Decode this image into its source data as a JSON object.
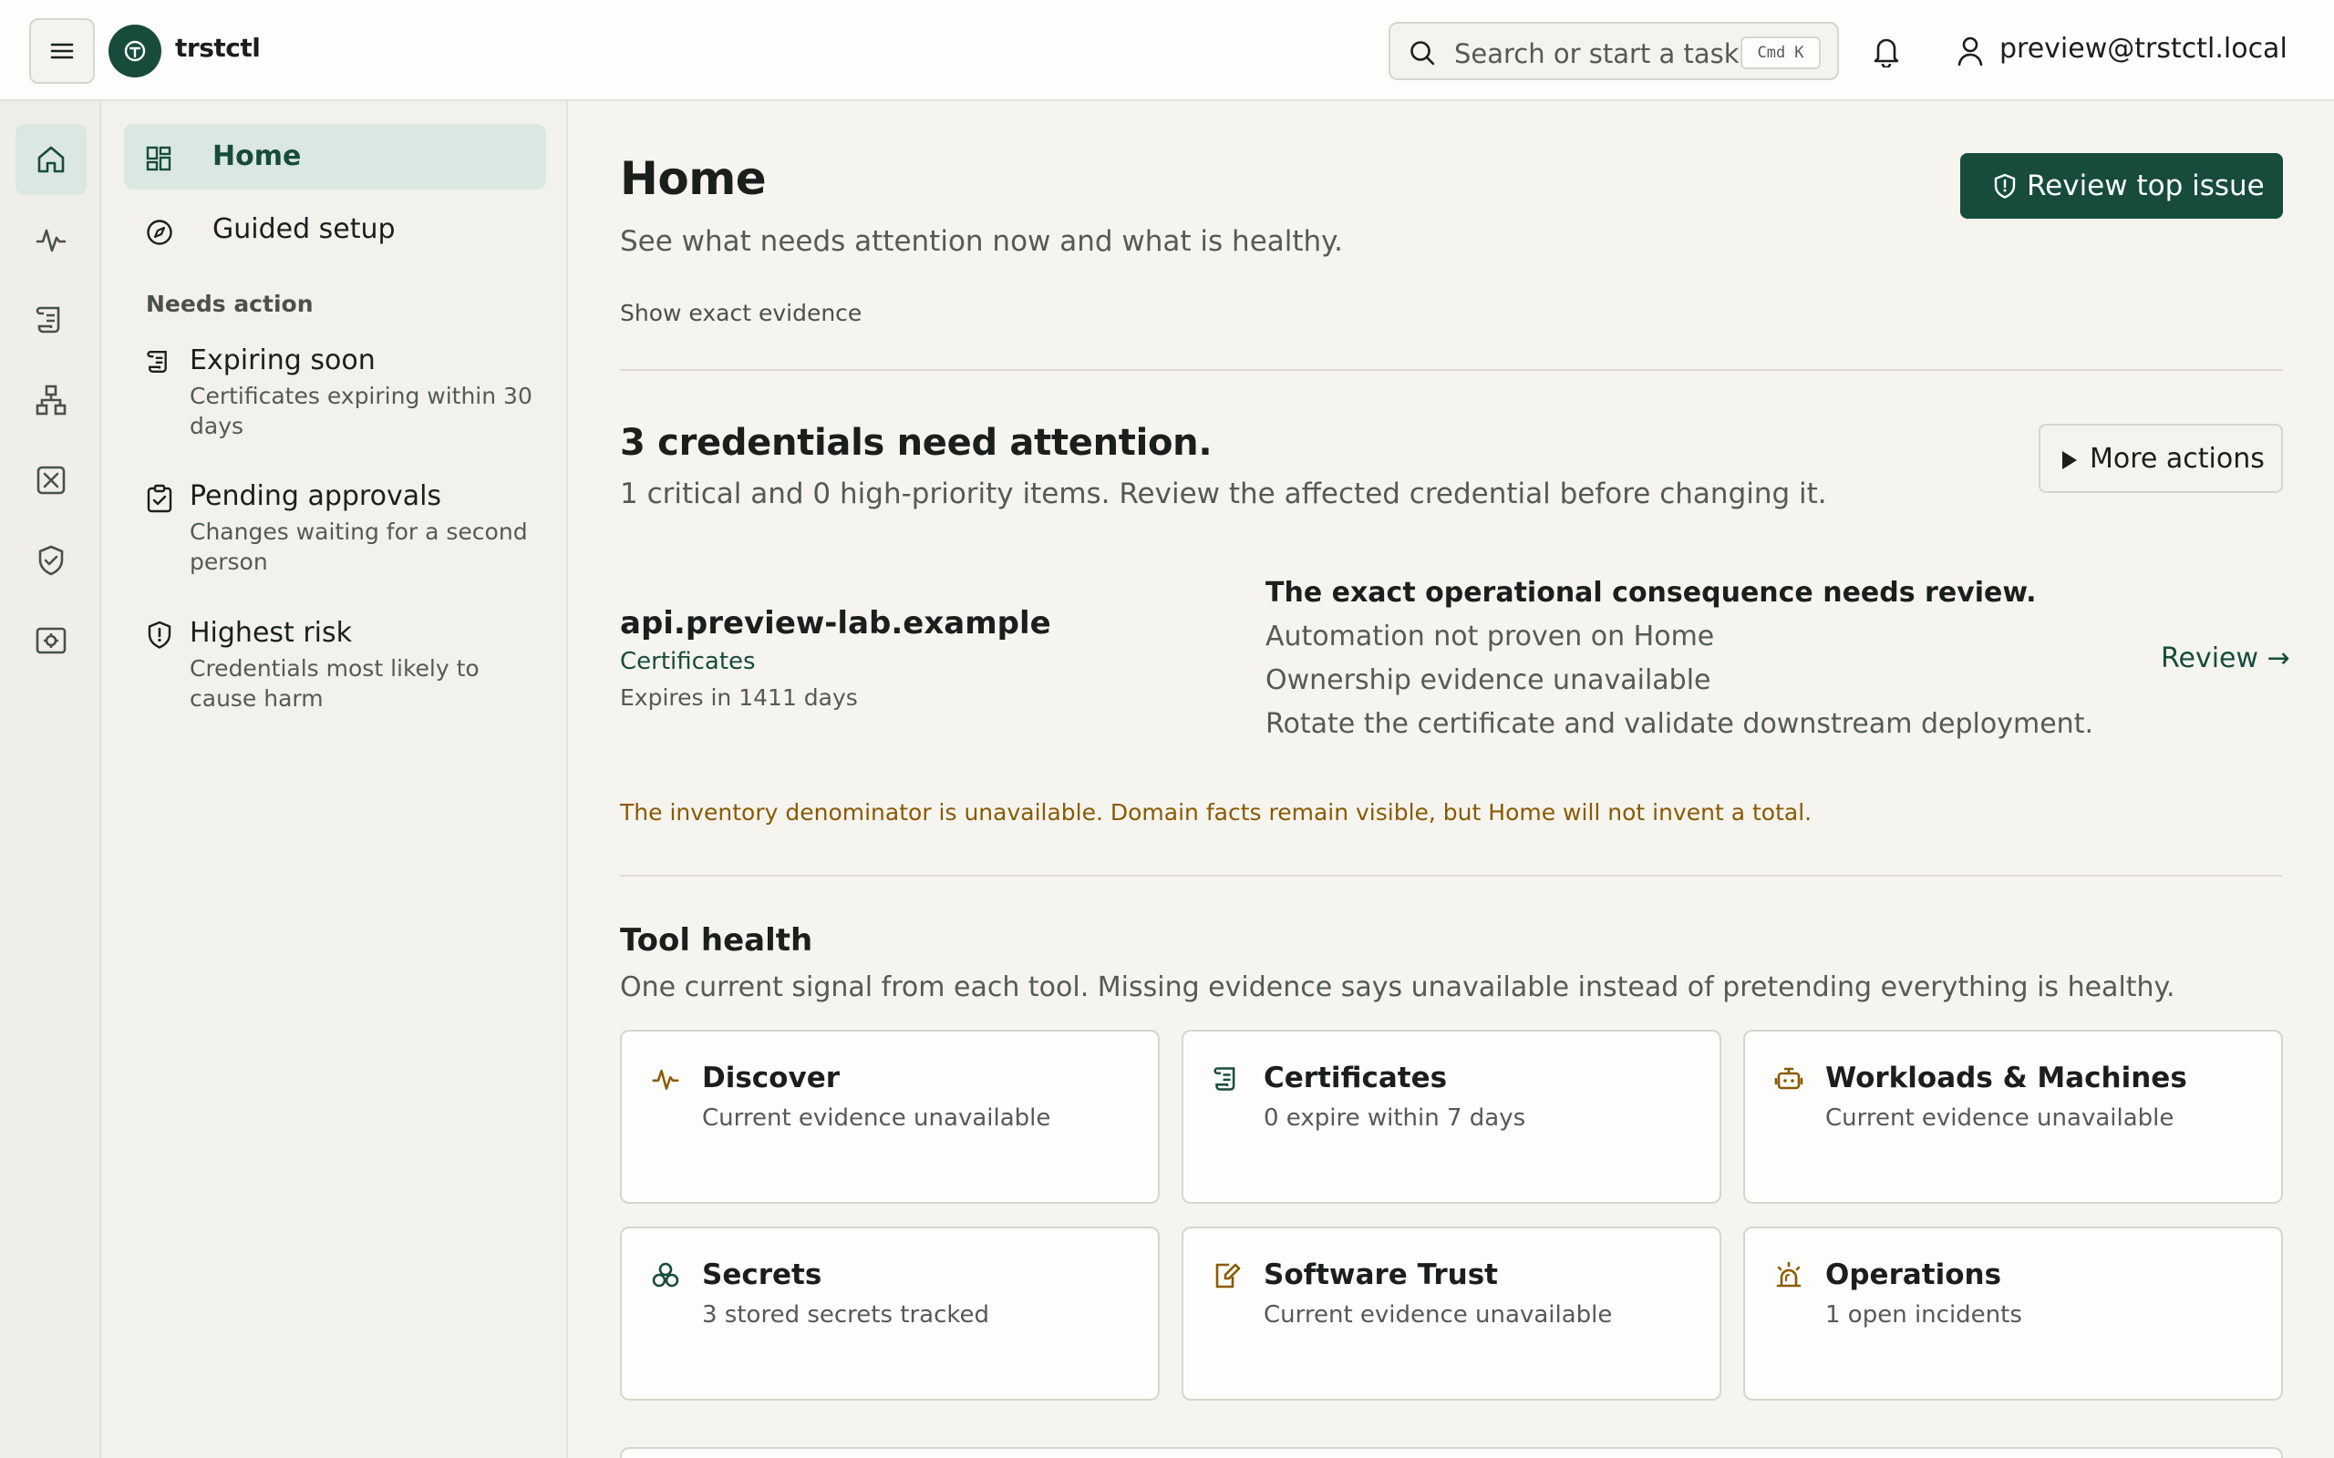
{
  "app": {
    "brand": "trstctl",
    "user_email": "preview@trstctl.local"
  },
  "search": {
    "placeholder": "Search or start a task",
    "shortcut_mod": "Cmd",
    "shortcut_key": "K"
  },
  "rail": {
    "items": [
      "home-icon",
      "activity-icon",
      "certificate-icon",
      "network-icon",
      "workload-icon",
      "shield-icon",
      "operations-icon"
    ]
  },
  "sidebar": {
    "nav": [
      {
        "label": "Home"
      },
      {
        "label": "Guided setup"
      }
    ],
    "section_label": "Needs action",
    "actions": [
      {
        "title": "Expiring soon",
        "desc": "Certificates expiring within 30 days"
      },
      {
        "title": "Pending approvals",
        "desc": "Changes waiting for a second person"
      },
      {
        "title": "Highest risk",
        "desc": "Credentials most likely to cause harm"
      }
    ]
  },
  "header": {
    "title": "Home",
    "subtitle": "See what needs attention now and what is healthy.",
    "show_evidence": "Show exact evidence",
    "primary_button": "Review top issue"
  },
  "attention": {
    "title": "3 credentials need attention.",
    "subtitle": "1 critical and 0 high-priority items. Review the affected credential before changing it.",
    "more_actions": "More actions",
    "credential": {
      "name": "api.preview-lab.example",
      "type": "Certificates",
      "expires": "Expires in 1411 days",
      "consequence_head": "The exact operational consequence needs review.",
      "consequence_lines": [
        "Automation not proven on Home",
        "Ownership evidence unavailable",
        "Rotate the certificate and validate downstream deployment."
      ],
      "review_link": "Review →"
    },
    "warning": "The inventory denominator is unavailable. Domain facts remain visible, but Home will not invent a total."
  },
  "tool_health": {
    "title": "Tool health",
    "subtitle": "One current signal from each tool. Missing evidence says unavailable instead of pretending everything is healthy.",
    "cards": [
      {
        "title": "Discover",
        "desc": "Current evidence unavailable",
        "icon": "activity-icon"
      },
      {
        "title": "Certificates",
        "desc": "0 expire within 7 days",
        "icon": "certificate-icon"
      },
      {
        "title": "Workloads & Machines",
        "desc": "Current evidence unavailable",
        "icon": "robot-icon"
      },
      {
        "title": "Secrets",
        "desc": "3 stored secrets tracked",
        "icon": "secrets-icon"
      },
      {
        "title": "Software Trust",
        "desc": "Current evidence unavailable",
        "icon": "signed-document-icon"
      },
      {
        "title": "Operations",
        "desc": "1 open incidents",
        "icon": "alarm-icon"
      }
    ]
  },
  "colors": {
    "accent": "#174c3c",
    "warning": "#8a5a00",
    "icon_amber": "#8a5a00"
  }
}
